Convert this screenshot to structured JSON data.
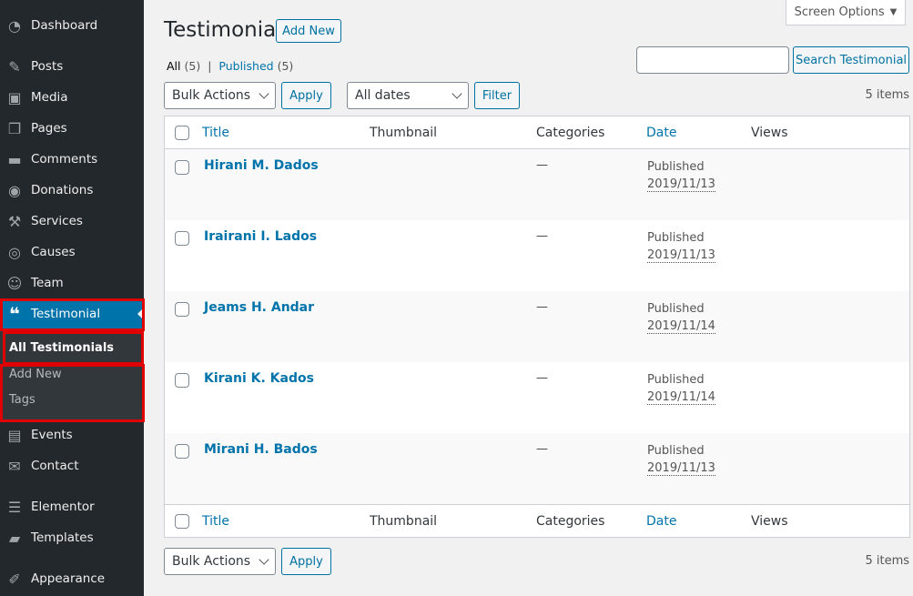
{
  "sidebar": {
    "items": [
      {
        "label": "Dashboard",
        "icon": "dashboard-icon"
      },
      {
        "label": "Posts",
        "icon": "pin-icon"
      },
      {
        "label": "Media",
        "icon": "media-icon"
      },
      {
        "label": "Pages",
        "icon": "pages-icon"
      },
      {
        "label": "Comments",
        "icon": "comment-icon"
      },
      {
        "label": "Donations",
        "icon": "donation-icon"
      },
      {
        "label": "Services",
        "icon": "hammer-icon"
      },
      {
        "label": "Causes",
        "icon": "eye-icon"
      },
      {
        "label": "Team",
        "icon": "user-circle-icon"
      },
      {
        "label": "Testimonial",
        "icon": "quote-icon"
      },
      {
        "label": "Events",
        "icon": "calendar-icon"
      },
      {
        "label": "Contact",
        "icon": "envelope-icon"
      },
      {
        "label": "Elementor",
        "icon": "elementor-icon"
      },
      {
        "label": "Templates",
        "icon": "folder-icon"
      },
      {
        "label": "Appearance",
        "icon": "paintbrush-icon"
      }
    ],
    "submenu": [
      "All Testimonials",
      "Add New",
      "Tags"
    ]
  },
  "header": {
    "title": "Testimonial",
    "add_new": "Add New",
    "screen_options": "Screen Options"
  },
  "views": {
    "all": "All",
    "all_count": "(5)",
    "sep": "|",
    "published": "Published",
    "published_count": "(5)"
  },
  "search": {
    "value": "",
    "button": "Search Testimonial"
  },
  "filters": {
    "bulk": "Bulk Actions",
    "apply": "Apply",
    "dates": "All dates",
    "filter": "Filter",
    "count": "5 items"
  },
  "table": {
    "columns": [
      "Title",
      "Thumbnail",
      "Categories",
      "Date",
      "Views"
    ],
    "rows": [
      {
        "title": "Hirani M. Dados",
        "categories": "—",
        "status": "Published",
        "date": "2019/11/13"
      },
      {
        "title": "Irairani I. Lados",
        "categories": "—",
        "status": "Published",
        "date": "2019/11/13"
      },
      {
        "title": "Jeams H. Andar",
        "categories": "—",
        "status": "Published",
        "date": "2019/11/14"
      },
      {
        "title": "Kirani K. Kados",
        "categories": "—",
        "status": "Published",
        "date": "2019/11/14"
      },
      {
        "title": "Mirani H. Bados",
        "categories": "—",
        "status": "Published",
        "date": "2019/11/13"
      }
    ]
  },
  "colors": {
    "sidebar": "#23282d",
    "active": "#0073aa",
    "highlight": "#e00000"
  }
}
